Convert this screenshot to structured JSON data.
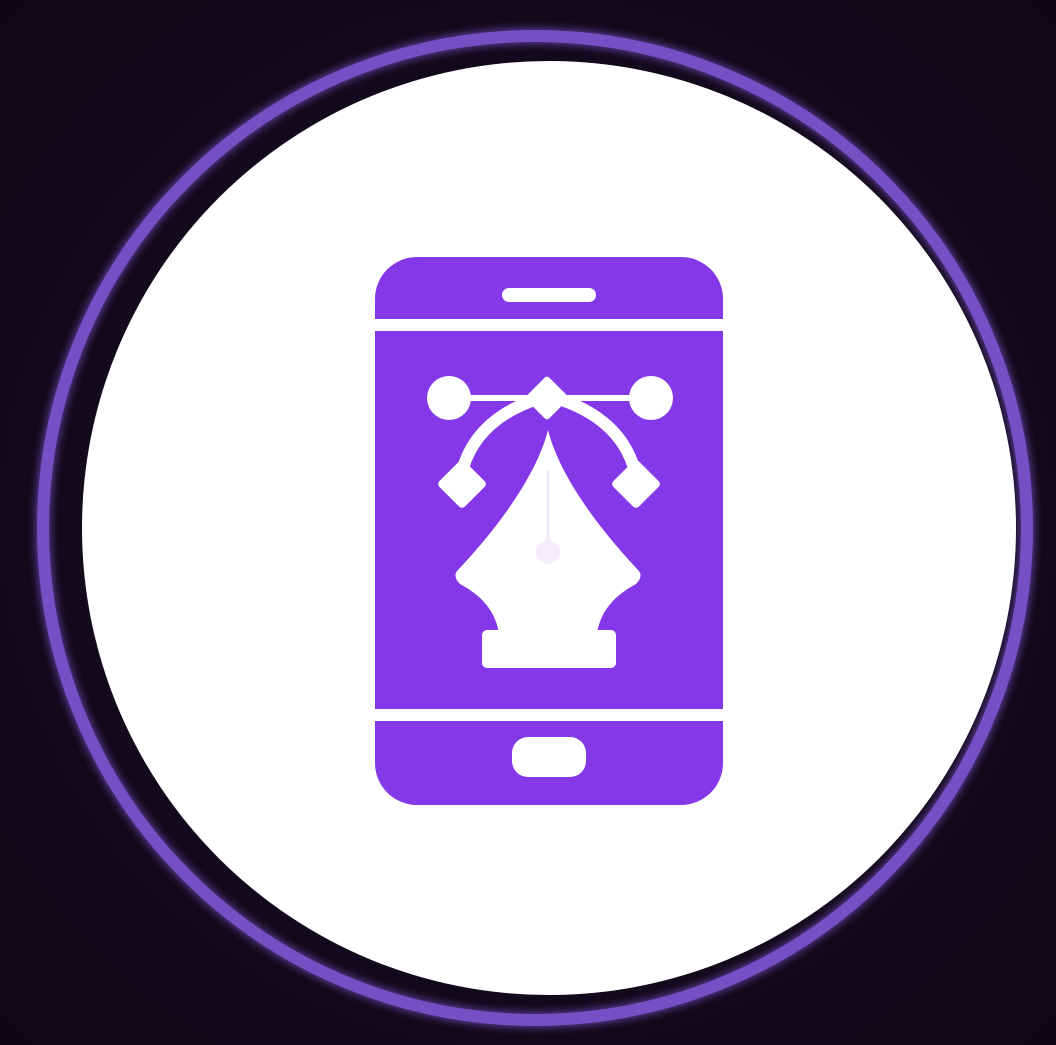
{
  "badge": {
    "icon": "mobile-design-pen-tool-icon",
    "colors": {
      "background": "#110818",
      "ring": "#7b52cf",
      "disc": "#ffffff",
      "icon": "#8438e8"
    }
  }
}
